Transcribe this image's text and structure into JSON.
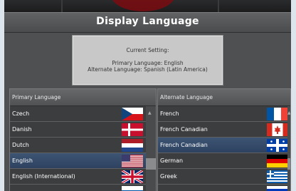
{
  "dialog": {
    "title": "Display Language"
  },
  "current_setting": {
    "heading": "Current Setting:",
    "primary_line": "Primary Language: English",
    "alternate_line": "Alternate Language: Spanish (Latin America)"
  },
  "primary_list": {
    "header": "Primary Language",
    "items": [
      {
        "label": "Czech",
        "flag": "czech-flag"
      },
      {
        "label": "Danish",
        "flag": "danish-flag"
      },
      {
        "label": "Dutch",
        "flag": "dutch-flag"
      },
      {
        "label": "English",
        "flag": "us-flag",
        "selected": true
      },
      {
        "label": "English (International)",
        "flag": "uk-flag"
      }
    ],
    "scroll_arrow": "▲"
  },
  "alternate_list": {
    "header": "Alternate Language",
    "items": [
      {
        "label": "French",
        "flag": "french-flag"
      },
      {
        "label": "French Canadian",
        "flag": "canadian-flag"
      },
      {
        "label": "French Canadian",
        "flag": "quebec-flag",
        "selected": true
      },
      {
        "label": "German",
        "flag": "german-flag"
      },
      {
        "label": "Greek",
        "flag": "greek-flag"
      }
    ],
    "scroll_arrow": "▲"
  }
}
